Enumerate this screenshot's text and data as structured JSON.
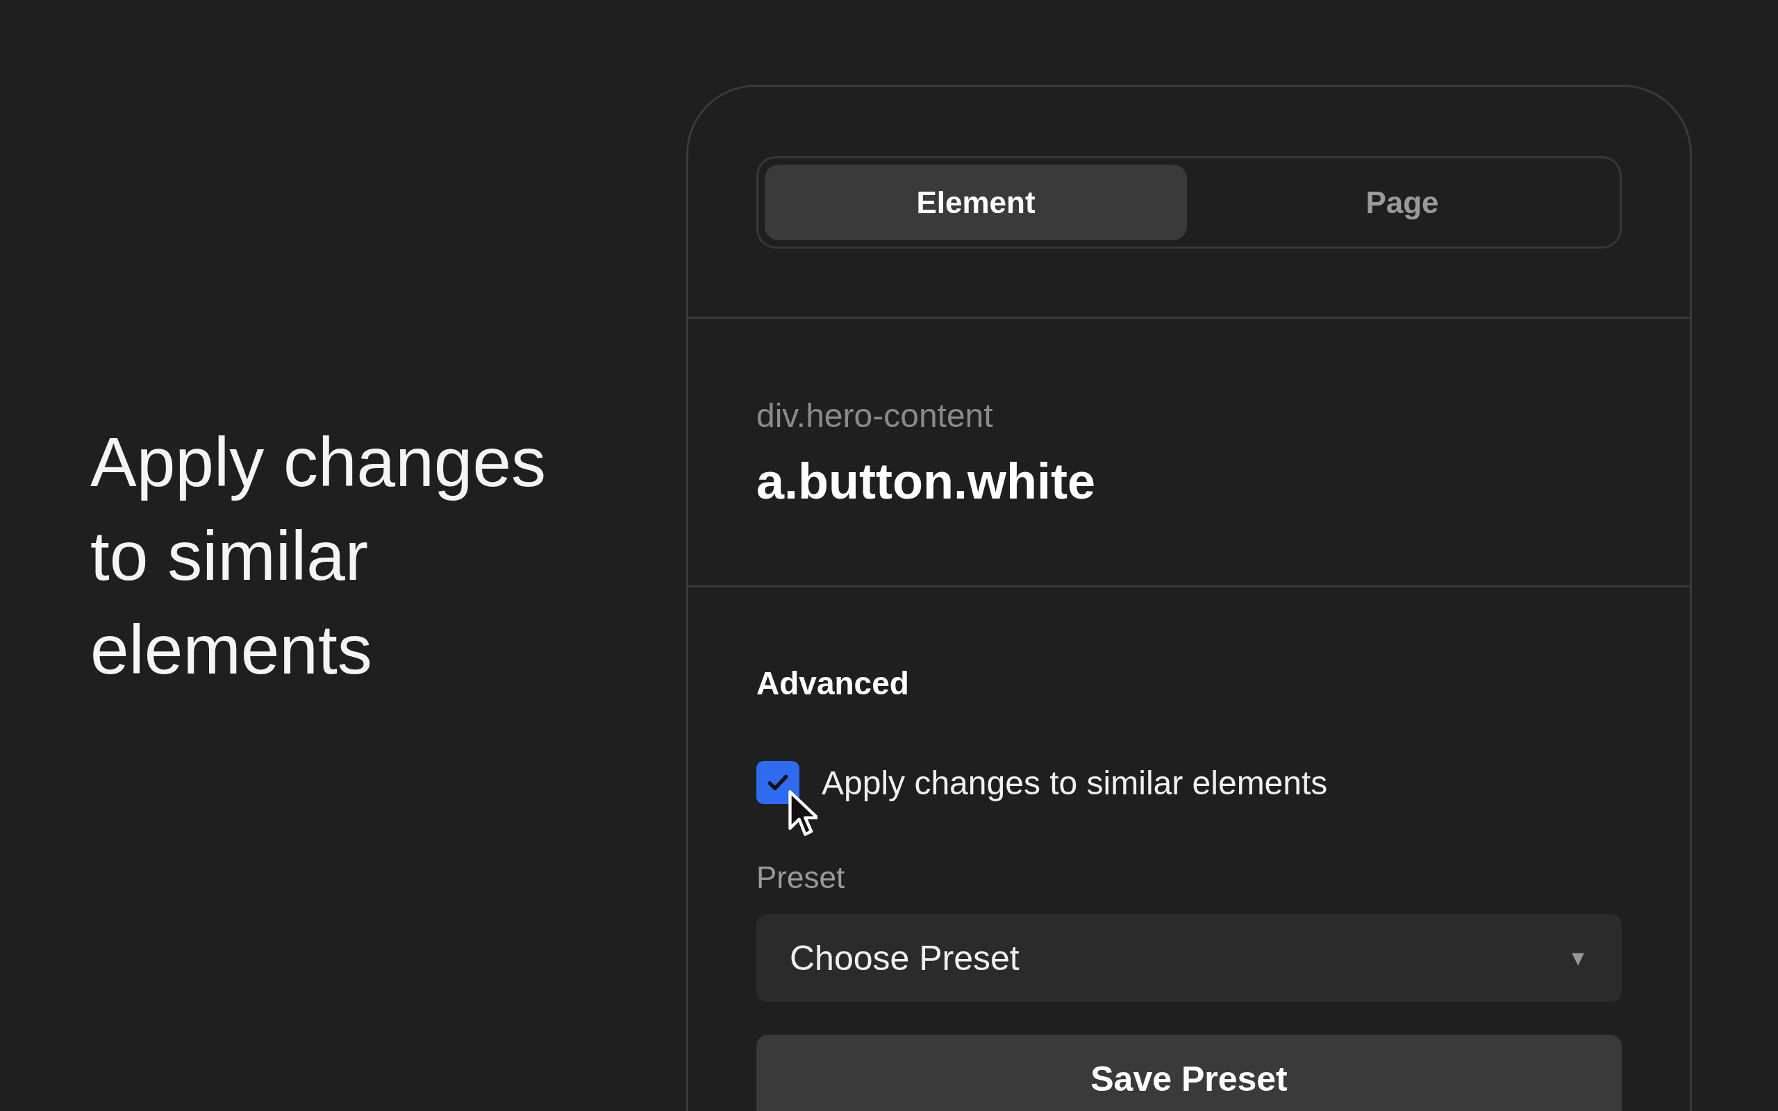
{
  "headline": "Apply changes to similar elements",
  "tabs": [
    {
      "label": "Element",
      "selected": true
    },
    {
      "label": "Page",
      "selected": false
    }
  ],
  "parent_selector": "div.hero-content",
  "selector": "a.button.white",
  "section_title": "Advanced",
  "checkbox": {
    "label": "Apply changes to similar elements",
    "checked": true
  },
  "preset": {
    "label": "Preset",
    "value": "Choose Preset",
    "caret": "▼"
  },
  "save_button": "Save Preset"
}
